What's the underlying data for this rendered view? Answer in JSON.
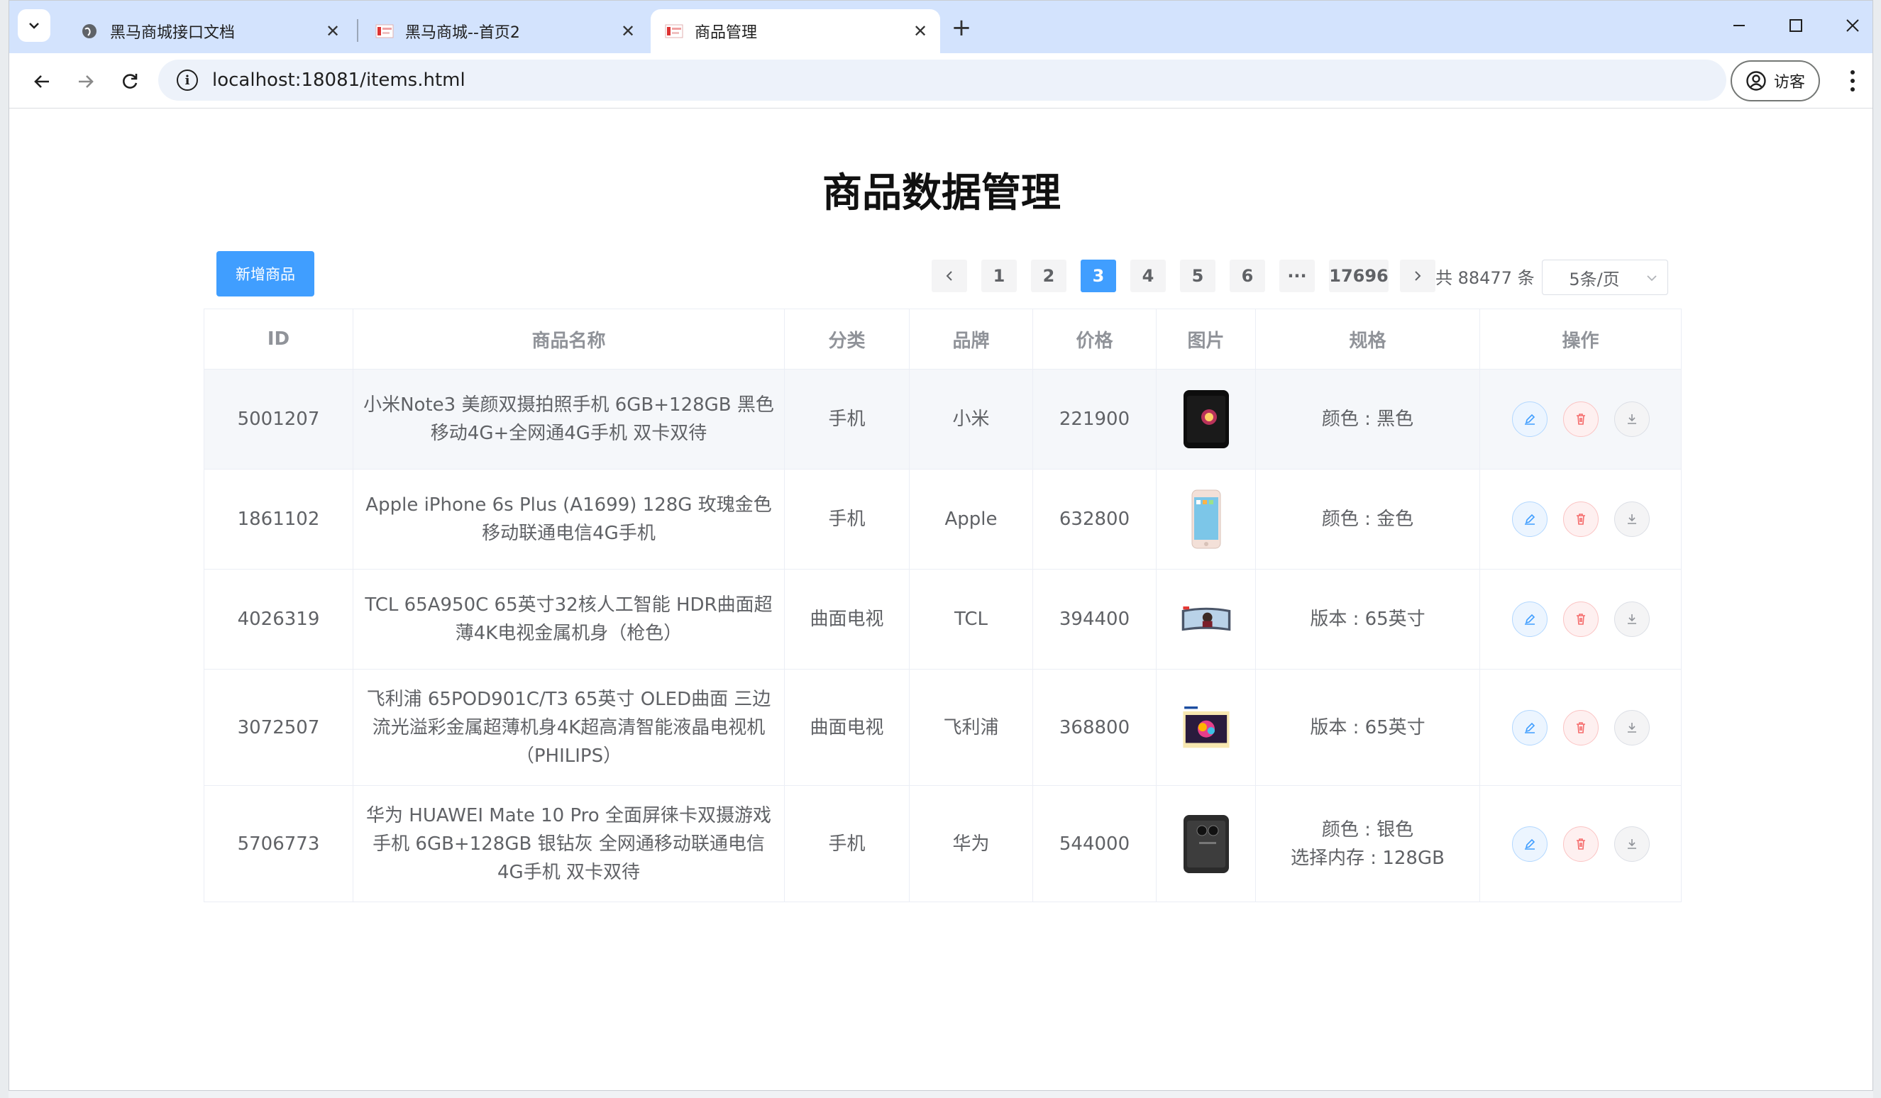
{
  "browser": {
    "tabs": [
      {
        "title": "黑马商城接口文档",
        "favicon": "globe-icon",
        "active": false
      },
      {
        "title": "黑马商城--首页2",
        "favicon": "site-favicon",
        "active": false
      },
      {
        "title": "商品管理",
        "favicon": "site-favicon",
        "active": true
      }
    ],
    "new_tab_label": "+",
    "url": "localhost:18081/items.html",
    "profile_label": "访客"
  },
  "page": {
    "title": "商品数据管理",
    "add_button_label": "新增商品",
    "pagination": {
      "pages": [
        "1",
        "2",
        "3",
        "4",
        "5",
        "6",
        "···",
        "17696"
      ],
      "current": "3",
      "total_label": "共 88477 条",
      "page_size_label": "5条/页"
    },
    "table": {
      "columns": [
        "ID",
        "商品名称",
        "分类",
        "品牌",
        "价格",
        "图片",
        "规格",
        "操作"
      ],
      "rows": [
        {
          "id": "5001207",
          "name": "小米Note3 美颜双摄拍照手机 6GB+128GB 黑色 移动4G+全网通4G手机 双卡双待",
          "category": "手机",
          "brand": "小米",
          "price": "221900",
          "spec_lines": [
            "颜色 : 黑色"
          ]
        },
        {
          "id": "1861102",
          "name": "Apple iPhone 6s Plus (A1699) 128G 玫瑰金色 移动联通电信4G手机",
          "category": "手机",
          "brand": "Apple",
          "price": "632800",
          "spec_lines": [
            "颜色 : 金色"
          ]
        },
        {
          "id": "4026319",
          "name": "TCL 65A950C 65英寸32核人工智能 HDR曲面超薄4K电视金属机身（枪色）",
          "category": "曲面电视",
          "brand": "TCL",
          "price": "394400",
          "spec_lines": [
            "版本 : 65英寸"
          ]
        },
        {
          "id": "3072507",
          "name": "飞利浦 65POD901C/T3 65英寸 OLED曲面 三边流光溢彩金属超薄机身4K超高清智能液晶电视机（PHILIPS）",
          "category": "曲面电视",
          "brand": "飞利浦",
          "price": "368800",
          "spec_lines": [
            "版本 : 65英寸"
          ]
        },
        {
          "id": "5706773",
          "name": "华为 HUAWEI Mate 10 Pro 全面屏徕卡双摄游戏手机 6GB+128GB 银钻灰 全网通移动联通电信4G手机 双卡双待",
          "category": "手机",
          "brand": "华为",
          "price": "544000",
          "spec_lines": [
            "颜色 : 银色",
            "选择内存 : 128GB"
          ]
        }
      ]
    }
  },
  "colors": {
    "primary": "#409eff",
    "danger": "#f56c6c",
    "tabstrip": "#d3e3fd"
  }
}
